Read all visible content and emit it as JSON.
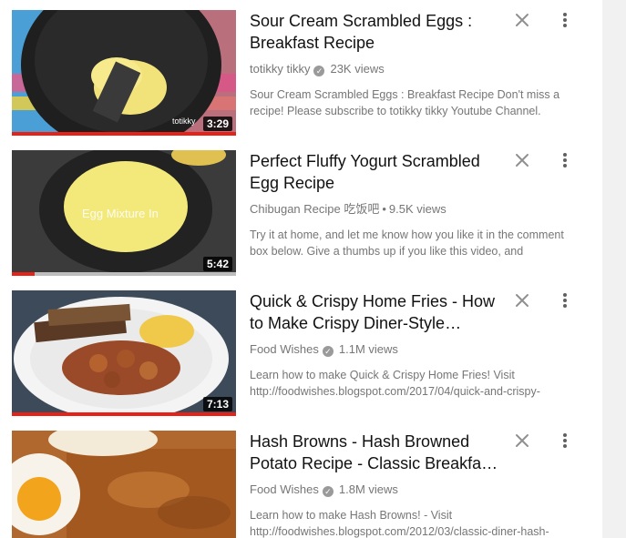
{
  "videos": [
    {
      "title": "Sour Cream Scrambled Eggs : Breakfast Recipe",
      "channel": "totikky tikky",
      "verified": true,
      "views": "23K views",
      "description": "Sour Cream Scrambled Eggs : Breakfast Recipe Don't miss a recipe! Please subscribe to totikky tikky Youtube Channel.",
      "duration": "3:29",
      "watermark": "totikky",
      "progress": 1.0
    },
    {
      "title": "Perfect Fluffy Yogurt Scrambled Egg Recipe",
      "channel": "Chibugan Recipe 吃饭吧",
      "verified": false,
      "views": "9.5K views",
      "description": "Try it at home, and let me know how you like it in the comment box below. Give a thumbs up if you like this video, and",
      "duration": "5:42",
      "overlay_text": "Egg Mixture In",
      "progress": 0.1
    },
    {
      "title": "Quick & Crispy Home Fries - How to Make Crispy Diner-Style Hom…",
      "channel": "Food Wishes",
      "verified": true,
      "views": "1.1M views",
      "description": "Learn how to make Quick & Crispy Home Fries! Visit http://foodwishes.blogspot.com/2017/04/quick-and-crispy-",
      "duration": "7:13",
      "progress": 1.0
    },
    {
      "title": "Hash Browns - Hash Browned Potato Recipe - Classic Breakfa…",
      "channel": "Food Wishes",
      "verified": true,
      "views": "1.8M views",
      "description": "Learn how to make Hash Browns! - Visit http://foodwishes.blogspot.com/2012/03/classic-diner-hash-",
      "duration": "",
      "progress": 0
    }
  ],
  "icons": {
    "close": "close-icon",
    "more": "more-vert-icon",
    "verified": "verified-check-icon"
  },
  "colors": {
    "progress": "#e62117",
    "meta_text": "#767676",
    "title_text": "#111111"
  }
}
